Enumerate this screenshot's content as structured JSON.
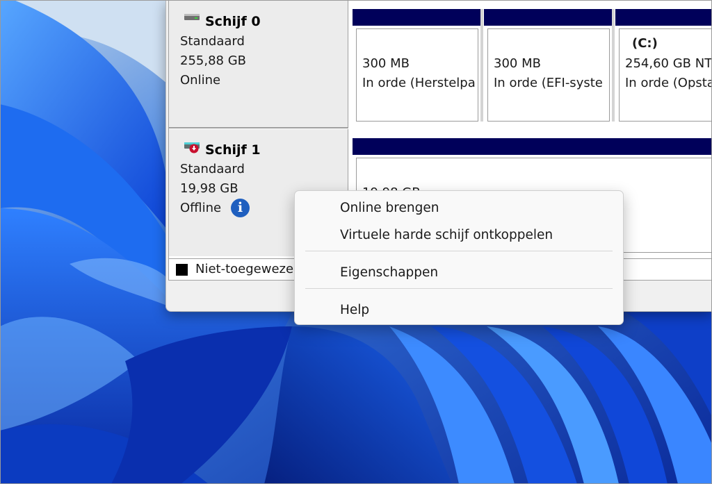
{
  "window": {
    "disks": [
      {
        "name": "Schijf 0",
        "type": "Standaard",
        "size": "255,88 GB",
        "status": "Online",
        "icon": "disk-icon",
        "partitions": [
          {
            "label": "",
            "size": "300 MB",
            "status": "In orde (Herstelpa"
          },
          {
            "label": "",
            "size": "300 MB",
            "status": "In orde (EFI-syste"
          },
          {
            "label": "(C:)",
            "size": "254,60 GB NT",
            "status": "In orde (Opsta"
          }
        ]
      },
      {
        "name": "Schijf 1",
        "type": "Standaard",
        "size": "19,98 GB",
        "status": "Offline",
        "icon": "offline-disk-icon",
        "status_icon": "info-icon",
        "partitions": [
          {
            "label": "",
            "size": "19,98 GB",
            "status": ""
          }
        ]
      }
    ],
    "legend": {
      "swatch_color": "#000000",
      "label": "Niet-toegewezen"
    },
    "colors": {
      "partition_bar": "#00005a"
    }
  },
  "context_menu": {
    "items": [
      {
        "label": "Online brengen"
      },
      {
        "label": "Virtuele harde schijf ontkoppelen"
      },
      {
        "label": "Eigenschappen"
      },
      {
        "label": "Help"
      }
    ]
  }
}
